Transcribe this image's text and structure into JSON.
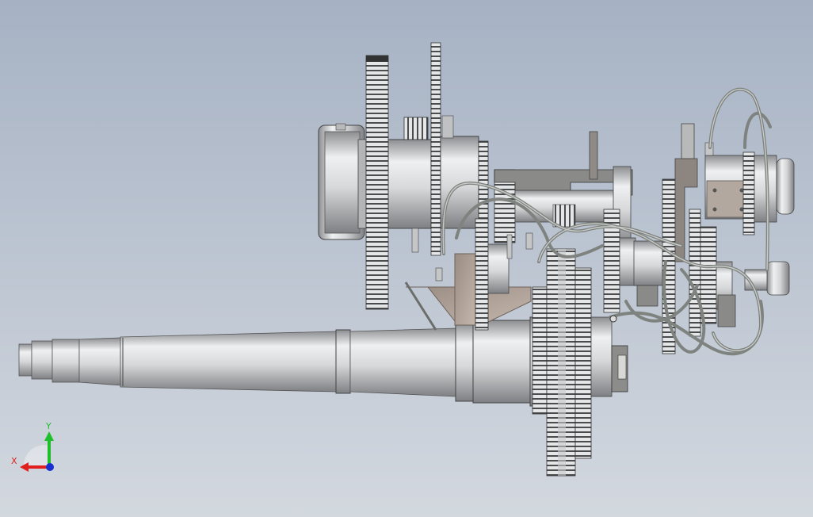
{
  "scene": {
    "background_top": "#a6b2c4",
    "background_bottom": "#d3d8df",
    "metal_light": "#eef0f1",
    "metal_mid": "#c2c4c6",
    "metal_dark": "#8a8c8f",
    "bracket_color": "#a89a8f",
    "hose_color": "#7f837f"
  },
  "triad": {
    "x_label": "X",
    "y_label": "Y",
    "x_color": "#e0201c",
    "y_color": "#1fbf2a",
    "z_color": "#1a2fd0"
  }
}
